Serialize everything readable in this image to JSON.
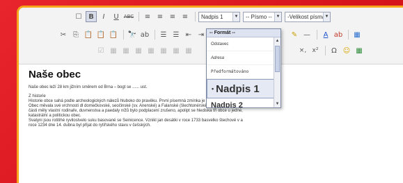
{
  "toolbar": {
    "row1": {
      "buttons": [
        "☐",
        "B",
        "I",
        "U",
        "ABC",
        "≡",
        "≡",
        "≡",
        "≡"
      ],
      "format_combo": "Nadpis 1",
      "font_combo": "-- Písmo --",
      "size_combo": "-Velikost písma-"
    },
    "row2": {
      "buttons": [
        "✂",
        "⎘",
        "📋",
        "📋",
        "📋",
        "🔭",
        "ab",
        "☰",
        "☰",
        "⇤",
        "⇥"
      ],
      "right_buttons": [
        "✎",
        "—",
        "A",
        "ab",
        "▦"
      ]
    },
    "row3": {
      "buttons": [
        "☑",
        "▦",
        "▦",
        "▦",
        "▦",
        "▦",
        "▦",
        "▦"
      ],
      "right_buttons": [
        "×,",
        "x²",
        "Ω",
        "☺",
        "▦"
      ]
    }
  },
  "dropdown": {
    "header": "-- Formát --",
    "items": [
      "Odstavec",
      "Adresa",
      "Předformátováno",
      "Nadpis 1",
      "Nadpis 2"
    ]
  },
  "document": {
    "title": "Naše obec",
    "intro": "Naše obec leží 28 km jižním směrem od Brna – bogt se ...... ust.",
    "section_label": "Z historie",
    "history_lines": [
      "Historie obce sahá podle archeologických nálezů hluboko do pravěku. První písemná zmínka je z roku 1234.",
      "Obec měvala své vrchnosti dl domečkovské, seočinské (sv. Anenské) a Falanské (šlechtonérské). Jednotlivé",
      "části měly vlastní rodinaře, duvnenstva a paedaly nížů bylo podplacení zrušeno, apolipt se hlediska tři obce u jedné,",
      "katastrální a politickou obec."
    ],
    "extra_lines": [
      "Svatyni jsou rotitihé ryvilostvelo suku basované se Seinicence. Vznikl jan desátki v roce 1733 basvelko štechové v a",
      "roce 1234 dne 14. dubna byl přijat do rytířského stavu v češských."
    ]
  },
  "colors": {
    "background": "#e02027",
    "frame_border": "#f5a61c",
    "selected": "#e4e9f4"
  }
}
